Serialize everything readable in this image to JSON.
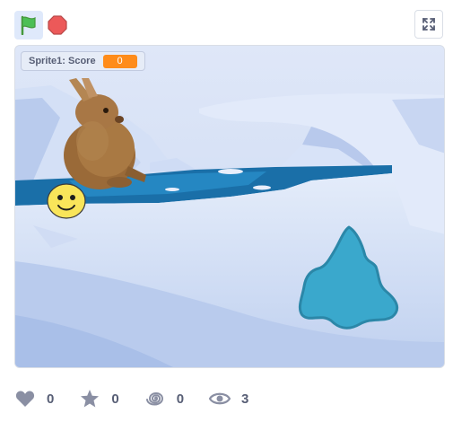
{
  "controls": {
    "green_flag_icon": "green-flag-icon",
    "stop_icon": "stop-sign-icon",
    "fullscreen_icon": "fullscreen-icon"
  },
  "stage": {
    "backdrop": "arctic-ice",
    "monitor": {
      "label": "Sprite1: Score",
      "value": "0",
      "value_color": "#ff8c1a"
    },
    "sprites": [
      "rabbit",
      "smiley-ball",
      "ice-shape"
    ]
  },
  "stats": {
    "loves": "0",
    "favorites": "0",
    "remixes": "0",
    "views": "3"
  },
  "colors": {
    "accent": "#4c97ff",
    "text": "#575e75",
    "water": "#1a6fa8",
    "ice_shape": "#3aa8cc"
  }
}
